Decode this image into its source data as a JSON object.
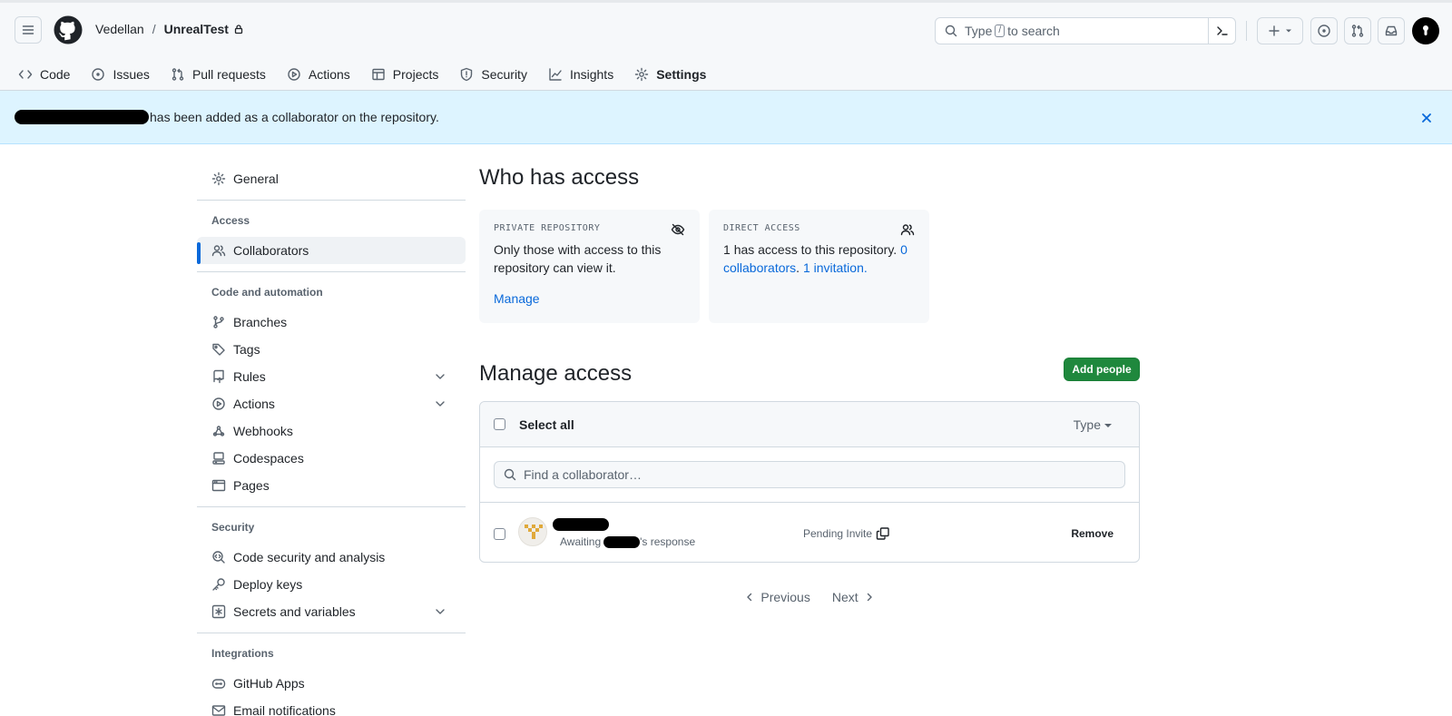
{
  "header": {
    "owner": "Vedellan",
    "separator": "/",
    "repo": "UnrealTest",
    "search_before": "Type",
    "search_key": "/",
    "search_after": "to search"
  },
  "tabs": [
    {
      "label": "Code",
      "icon": "code-icon"
    },
    {
      "label": "Issues",
      "icon": "issue-icon"
    },
    {
      "label": "Pull requests",
      "icon": "pull-request-icon"
    },
    {
      "label": "Actions",
      "icon": "play-icon"
    },
    {
      "label": "Projects",
      "icon": "table-icon"
    },
    {
      "label": "Security",
      "icon": "shield-icon"
    },
    {
      "label": "Insights",
      "icon": "graph-icon"
    },
    {
      "label": "Settings",
      "icon": "gear-icon",
      "active": true
    }
  ],
  "flash": {
    "message": "has been added as a collaborator on the repository."
  },
  "sidebar": {
    "general": "General",
    "access_heading": "Access",
    "collaborators": "Collaborators",
    "code_heading": "Code and automation",
    "branches": "Branches",
    "tags": "Tags",
    "rules": "Rules",
    "actions": "Actions",
    "webhooks": "Webhooks",
    "codespaces": "Codespaces",
    "pages": "Pages",
    "security_heading": "Security",
    "code_security": "Code security and analysis",
    "deploy_keys": "Deploy keys",
    "secrets": "Secrets and variables",
    "integrations_heading": "Integrations",
    "github_apps": "GitHub Apps",
    "email_notifications": "Email notifications"
  },
  "main": {
    "title": "Who has access",
    "private_card": {
      "kicker": "PRIVATE REPOSITORY",
      "description": "Only those with access to this repository can view it.",
      "link": "Manage"
    },
    "direct_card": {
      "kicker": "DIRECT ACCESS",
      "count": "1",
      "text": "has access to this repository.",
      "collaborators_link": "0 collaborators",
      "invitation_link": "1 invitation"
    },
    "manage_title": "Manage access",
    "add_button": "Add people",
    "select_all": "Select all",
    "type_filter": "Type",
    "find_placeholder": "Find a collaborator…",
    "row": {
      "awaiting": "Awaiting",
      "response": "'s response",
      "pending": "Pending Invite",
      "remove": "Remove"
    },
    "pager": {
      "previous": "Previous",
      "next": "Next"
    }
  },
  "colors": {
    "accent_blue": "#0969da",
    "primary_green": "#1f883d",
    "active_tab_underline": "#fd8c73",
    "flash_background": "#ddf4ff"
  }
}
